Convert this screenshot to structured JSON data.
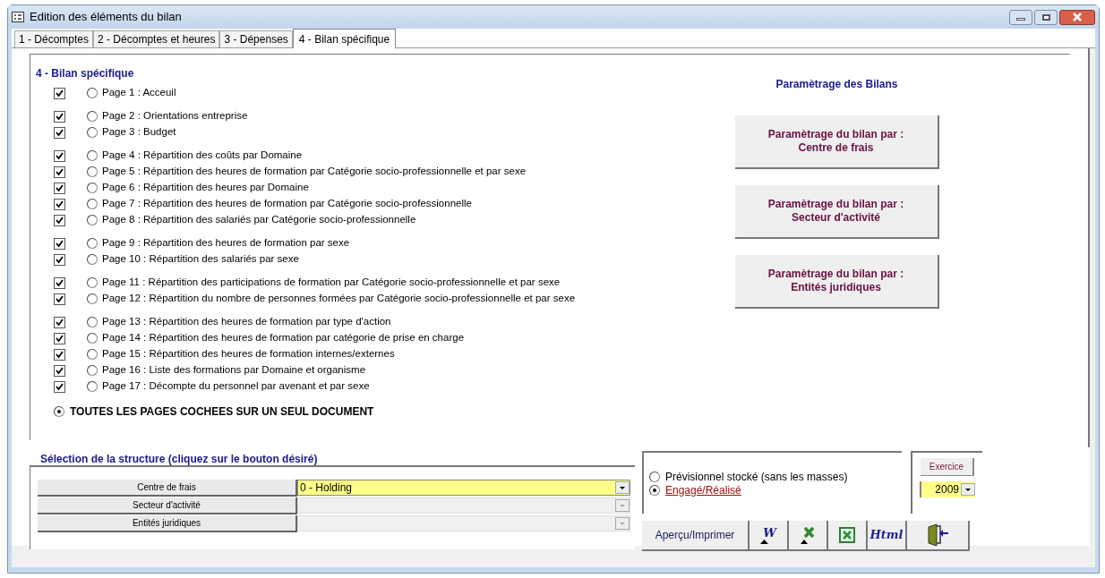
{
  "window": {
    "title": "Edition des éléments du bilan"
  },
  "tabs": [
    {
      "label": "1 - Décomptes",
      "selected": false
    },
    {
      "label": "2 - Décomptes et heures",
      "selected": false
    },
    {
      "label": "3 - Dépenses",
      "selected": false
    },
    {
      "label": "4 - Bilan spécifique",
      "selected": true
    }
  ],
  "section_title": "4 - Bilan spécifique",
  "page_groups": [
    {
      "pages": [
        {
          "label": "Page 1 : Acceuil",
          "checked": true,
          "selected": false
        }
      ]
    },
    {
      "pages": [
        {
          "label": "Page 2 : Orientations entreprise",
          "checked": true,
          "selected": false
        },
        {
          "label": "Page 3 : Budget",
          "checked": true,
          "selected": false
        }
      ]
    },
    {
      "pages": [
        {
          "label": "Page 4 : Répartition des coûts par Domaine",
          "checked": true,
          "selected": false
        },
        {
          "label": "Page 5 : Répartition des heures de formation par Catégorie socio-professionnelle et par sexe",
          "checked": true,
          "selected": false
        },
        {
          "label": "Page 6 : Répartition des heures par Domaine",
          "checked": true,
          "selected": false
        },
        {
          "label": "Page 7 : Répartition des heures de formation par Catégorie socio-professionnelle",
          "checked": true,
          "selected": false
        },
        {
          "label": "Page 8 : Répartition des salariés par Catégorie socio-professionnelle",
          "checked": true,
          "selected": false
        }
      ]
    },
    {
      "pages": [
        {
          "label": "Page 9 : Répartition des heures de formation par sexe",
          "checked": true,
          "selected": false
        },
        {
          "label": "Page 10 : Répartition des salariés par sexe",
          "checked": true,
          "selected": false
        }
      ]
    },
    {
      "pages": [
        {
          "label": "Page 11 : Répartition des participations de formation par Catégorie socio-professionnelle et par sexe",
          "checked": true,
          "selected": false
        },
        {
          "label": "Page 12 : Répartition du nombre de personnes formées par Catégorie socio-professionnelle et par sexe",
          "checked": true,
          "selected": false
        }
      ]
    },
    {
      "pages": [
        {
          "label": "Page 13 : Répartition des heures de formation par type d'action",
          "checked": true,
          "selected": false
        },
        {
          "label": "Page 14 : Répartition des heures de formation par catégorie de prise en charge",
          "checked": true,
          "selected": false
        },
        {
          "label": "Page 15 : Répartition des heures de formation internes/externes",
          "checked": true,
          "selected": false
        },
        {
          "label": "Page 16 : Liste des formations par Domaine et organisme",
          "checked": true,
          "selected": false
        },
        {
          "label": "Page 17 : Décompte du personnel par avenant et par sexe",
          "checked": true,
          "selected": false
        }
      ]
    }
  ],
  "all_pages": {
    "label": "TOUTES LES PAGES COCHEES SUR UN SEUL DOCUMENT",
    "selected": true
  },
  "settings": {
    "title": "Paramètrage des Bilans",
    "buttons": [
      {
        "line1": "Paramètrage du bilan par :",
        "line2": "Centre de frais"
      },
      {
        "line1": "Paramètrage du bilan par :",
        "line2": "Secteur d'activité"
      },
      {
        "line1": "Paramètrage du bilan par :",
        "line2": "Entités juridiques"
      }
    ]
  },
  "structure": {
    "title": "Sélection de la structure (cliquez sur le bouton désiré)",
    "rows": [
      {
        "label": "Centre de frais",
        "value": "0 - Holding",
        "disabled": false
      },
      {
        "label": "Secteur d'activité",
        "disabled": true
      },
      {
        "label": "Entités juridiques",
        "disabled": true
      }
    ]
  },
  "mode": [
    {
      "label": "Prévisionnel stocké (sans les masses)",
      "selected": false
    },
    {
      "label": "Engagé/Réalisé",
      "selected": true
    }
  ],
  "exercise": {
    "label": "Exercice",
    "value": "2009"
  },
  "actions": [
    {
      "kind": "text",
      "label": "Aperçu/Imprimer"
    },
    {
      "kind": "word",
      "label": "W"
    },
    {
      "kind": "excel-arrow"
    },
    {
      "kind": "excel"
    },
    {
      "kind": "html",
      "label": "Html"
    },
    {
      "kind": "exit"
    }
  ]
}
